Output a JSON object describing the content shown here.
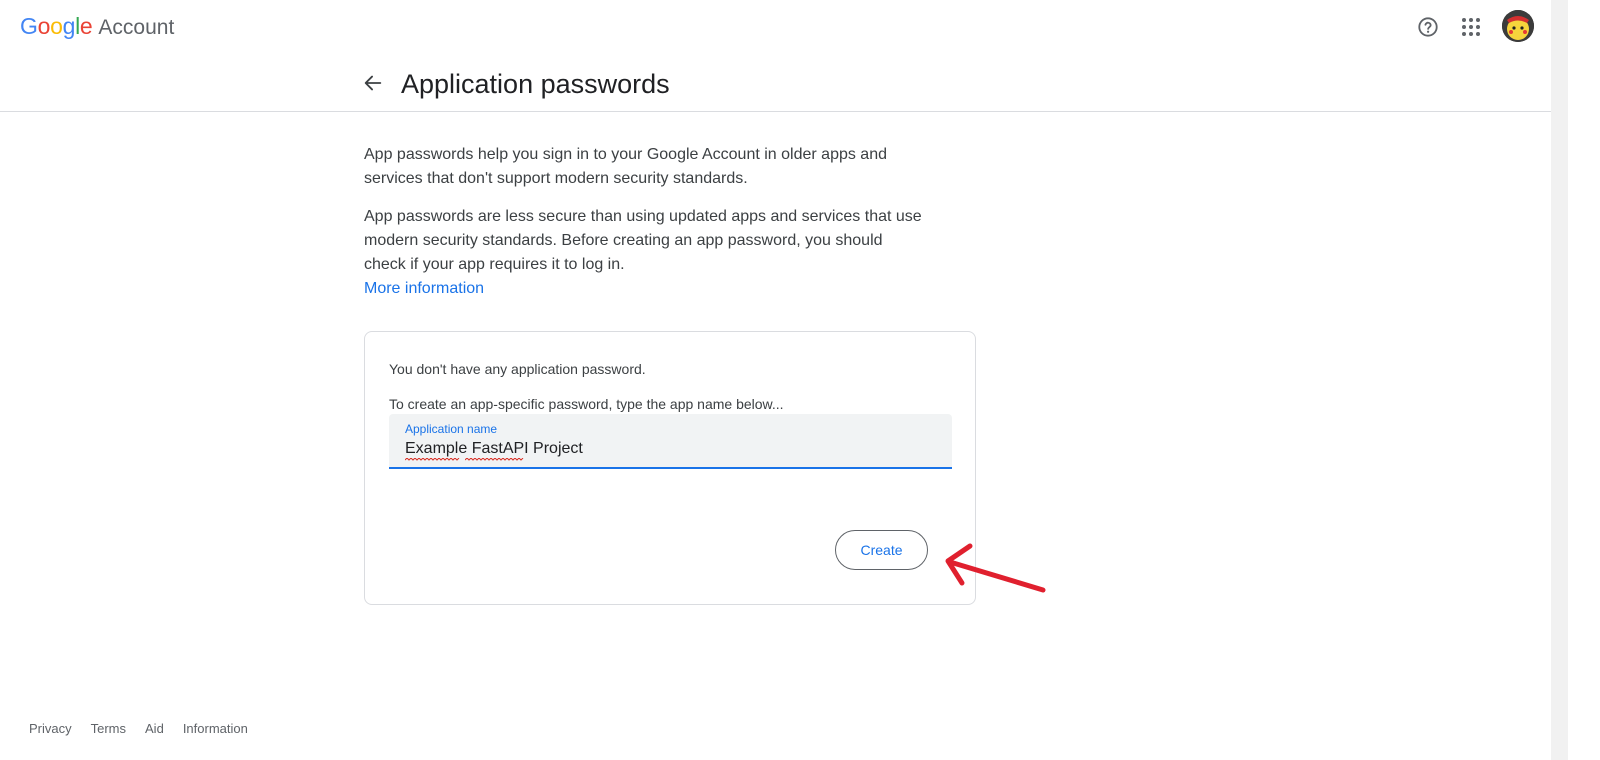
{
  "header": {
    "logo_google": "Google",
    "logo_account": "Account",
    "help_icon": "help-circle-icon",
    "apps_icon": "apps-grid-icon"
  },
  "page": {
    "title": "Application passwords",
    "back_icon": "arrow-left-icon"
  },
  "intro": {
    "para1": "App passwords help you sign in to your Google Account in older apps and services that don't support modern security standards.",
    "para2": "App passwords are less secure than using updated apps and services that use modern security standards. Before creating an app password, you should check if your app requires it to log in.",
    "more_link": "More information"
  },
  "card": {
    "no_passwords": "You don't have any application password.",
    "instruction": "To create an app-specific password, type the app name below...",
    "field_label": "Application name",
    "field_value": "Example FastAPI Project",
    "create_button": "Create"
  },
  "footer": {
    "links": [
      "Privacy",
      "Terms",
      "Aid",
      "Information"
    ]
  },
  "colors": {
    "accent": "#1a73e8",
    "annotation_arrow": "#e0202e"
  }
}
